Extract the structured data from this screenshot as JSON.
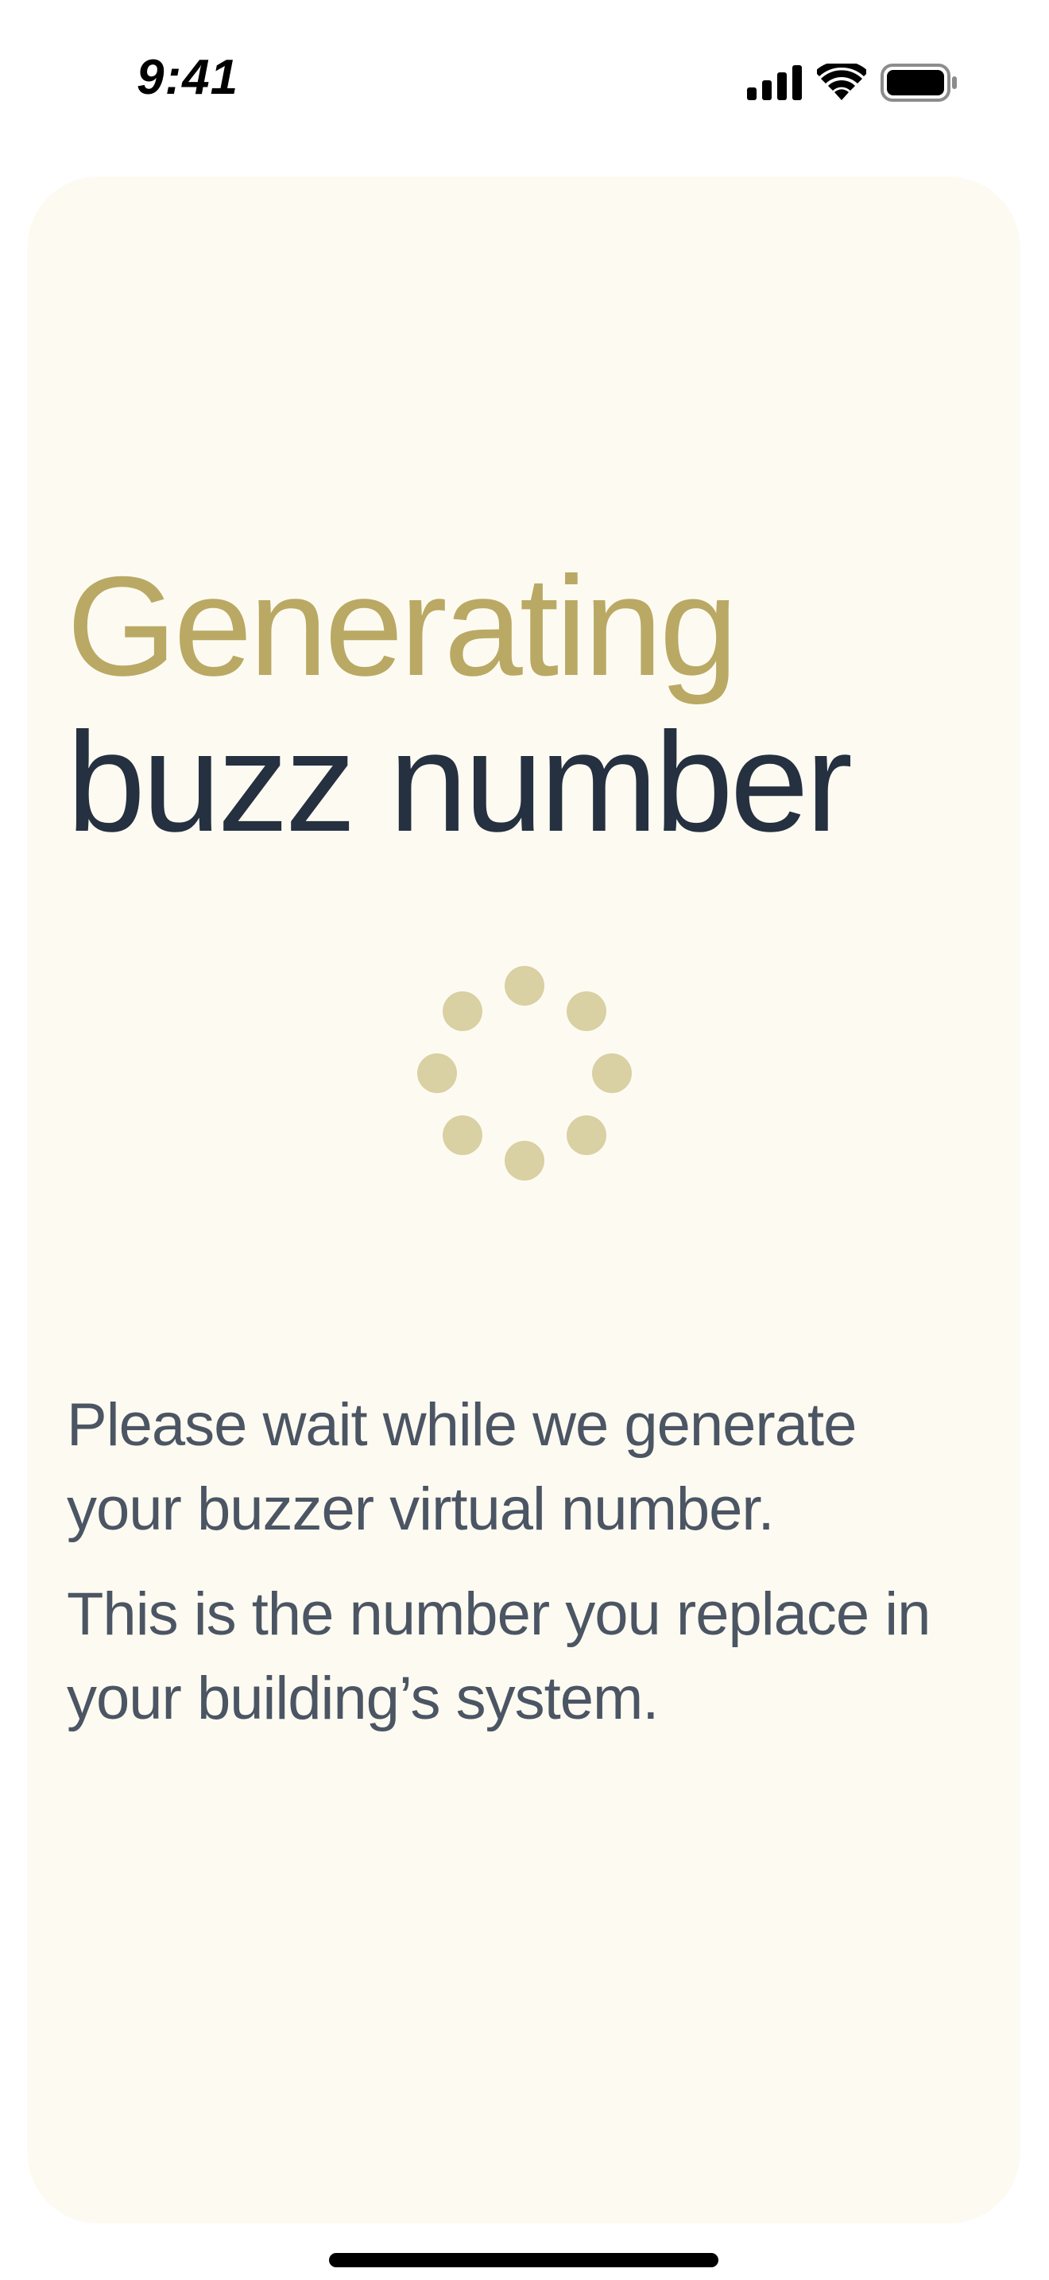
{
  "status_bar": {
    "time": "9:41",
    "icons": [
      "cellular-signal-icon",
      "wifi-icon",
      "battery-icon"
    ]
  },
  "main": {
    "title_highlight": "Generating",
    "title_rest": "buzz number",
    "spinner": "loading-spinner-icon",
    "description_1": "Please wait while we generate your buzzer virtual number.",
    "description_2": "This is the number you replace in your building’s system."
  },
  "colors": {
    "card_background": "#fdfbf1",
    "title_accent": "#b9a964",
    "title_dark": "#253040",
    "body_text": "#4b5563",
    "spinner_dots": "#d9d0a3"
  }
}
